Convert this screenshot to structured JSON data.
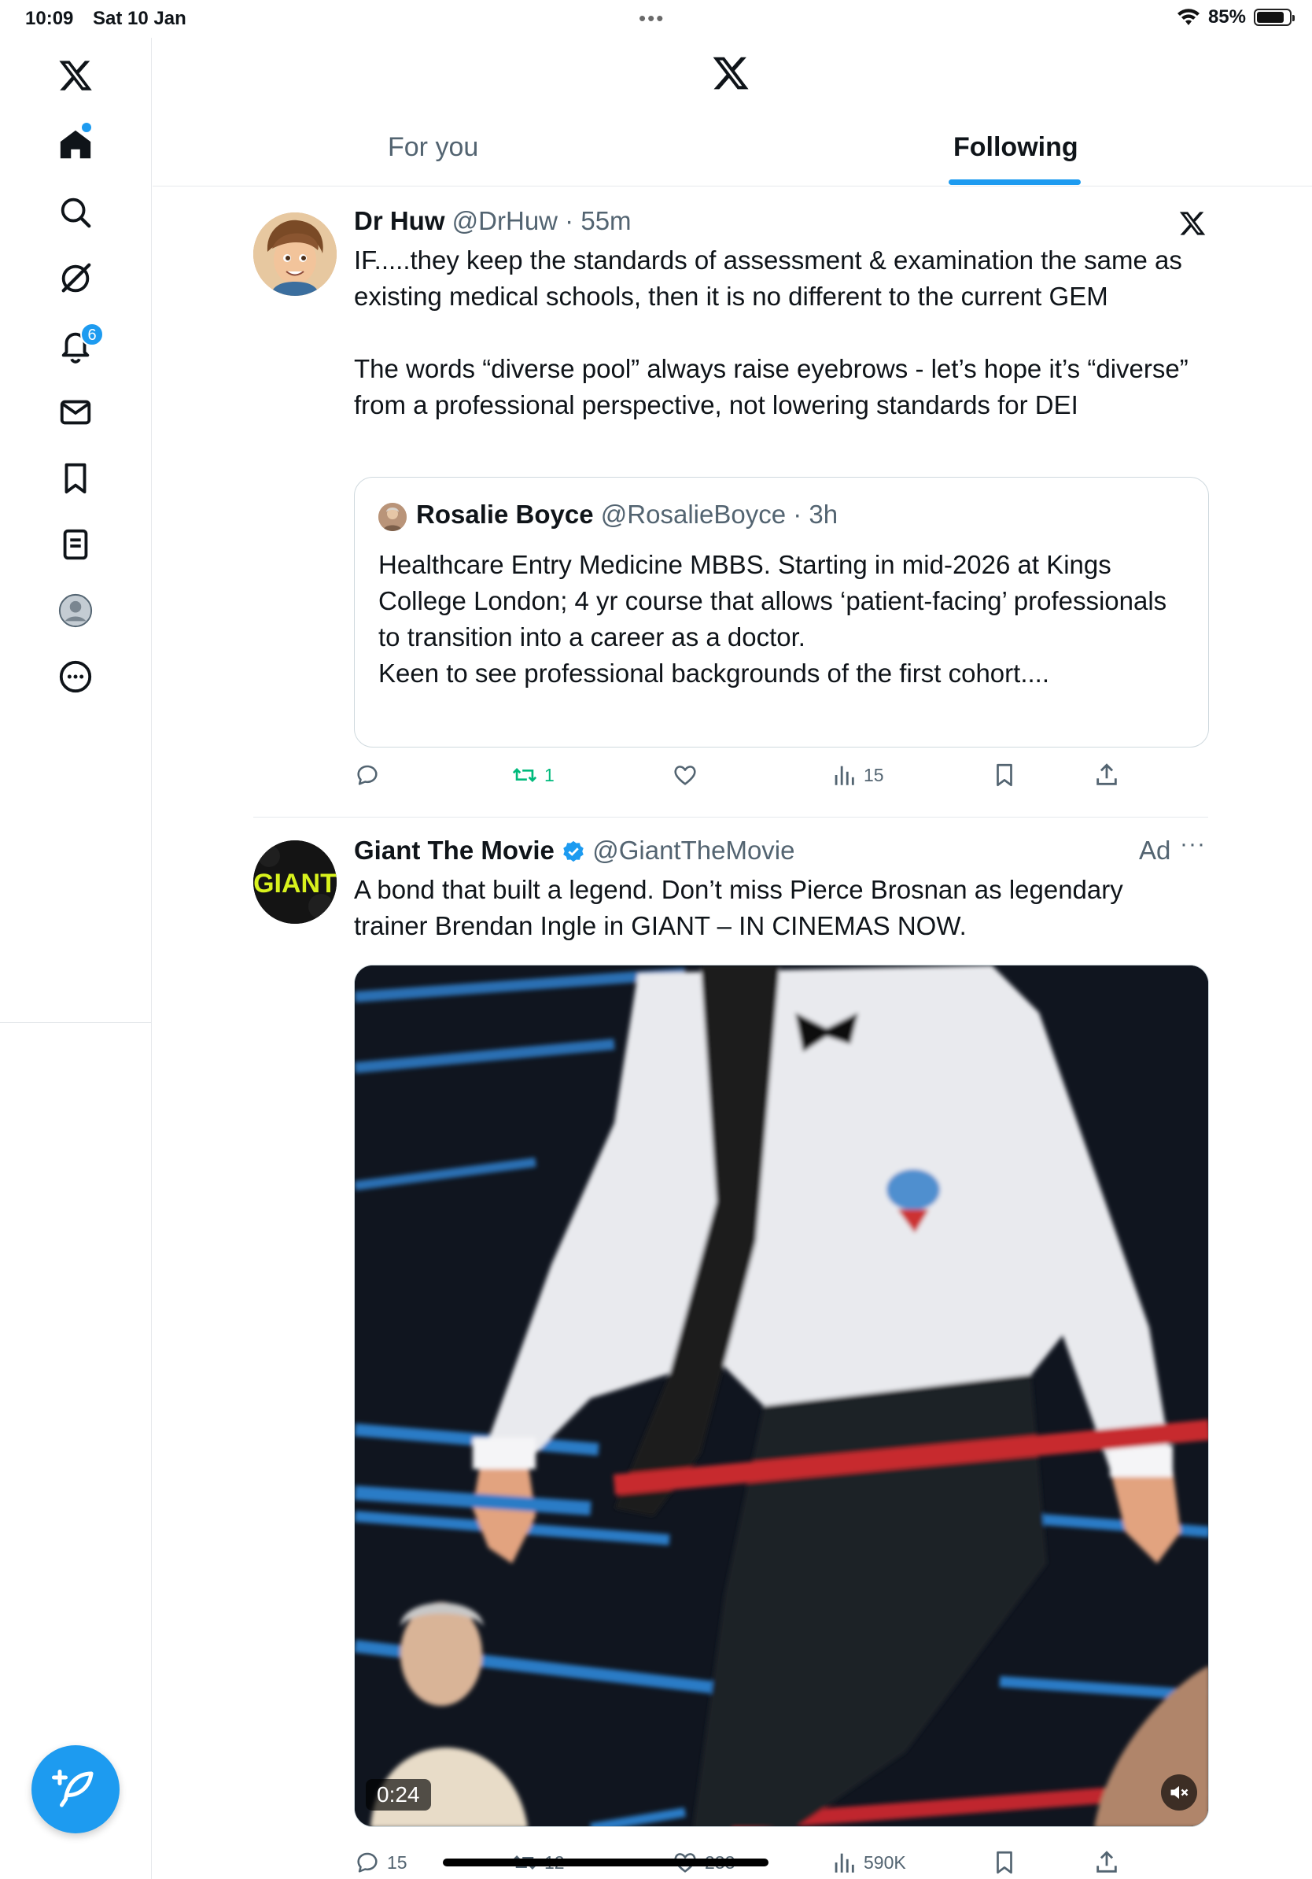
{
  "status_bar": {
    "time": "10:09",
    "date": "Sat 10 Jan",
    "battery": "85%",
    "battery_level": 0.85
  },
  "sidebar": {
    "items": [
      {
        "name": "x-logo-icon"
      },
      {
        "name": "home-icon",
        "has_dot": true
      },
      {
        "name": "search-icon"
      },
      {
        "name": "grok-icon"
      },
      {
        "name": "notifications-icon",
        "badge": "6"
      },
      {
        "name": "messages-icon"
      },
      {
        "name": "bookmarks-icon"
      },
      {
        "name": "lists-icon"
      },
      {
        "name": "profile-icon"
      },
      {
        "name": "more-icon"
      }
    ],
    "compose": {
      "name": "compose-icon"
    }
  },
  "header": {
    "tabs": [
      {
        "label": "For you",
        "active": false
      },
      {
        "label": "Following",
        "active": true
      }
    ]
  },
  "posts": [
    {
      "name": "Dr Huw",
      "handle": "@DrHuw",
      "time": "55m",
      "text_p1": "IF.....they keep the standards of assessment & examination the same as existing medical schools, then it is no different to the current GEM",
      "text_p2": "The words “diverse pool” always raise eyebrows - let’s hope it’s “diverse” from a professional perspective, not lowering standards for DEI",
      "quote": {
        "name": "Rosalie Boyce",
        "handle": "@RosalieBoyce",
        "time": "3h",
        "text_p1": "Healthcare Entry Medicine MBBS. Starting in mid-2026 at Kings College London; 4 yr course that allows ‘patient-facing’ professionals to transition into a career as a doctor.",
        "text_p2": "Keen to see professional backgrounds of the first cohort...."
      },
      "stats": {
        "replies": "",
        "reposts": "1",
        "likes": "",
        "views": "15"
      }
    },
    {
      "name": "Giant The Movie",
      "handle": "@GiantTheMovie",
      "verified": true,
      "ad_label": "Ad",
      "avatar_text": "GIANT",
      "text": "A bond that built a legend. Don’t miss Pierce Brosnan as legendary trainer Brendan Ingle in GIANT – IN CINEMAS NOW.",
      "video_time": "0:24",
      "stats": {
        "replies": "15",
        "reposts": "12",
        "likes": "233",
        "views": "590K"
      }
    }
  ],
  "colors": {
    "accent": "#1d9bf0",
    "repost_green": "#00ba7c",
    "secondary_text": "#536471"
  }
}
